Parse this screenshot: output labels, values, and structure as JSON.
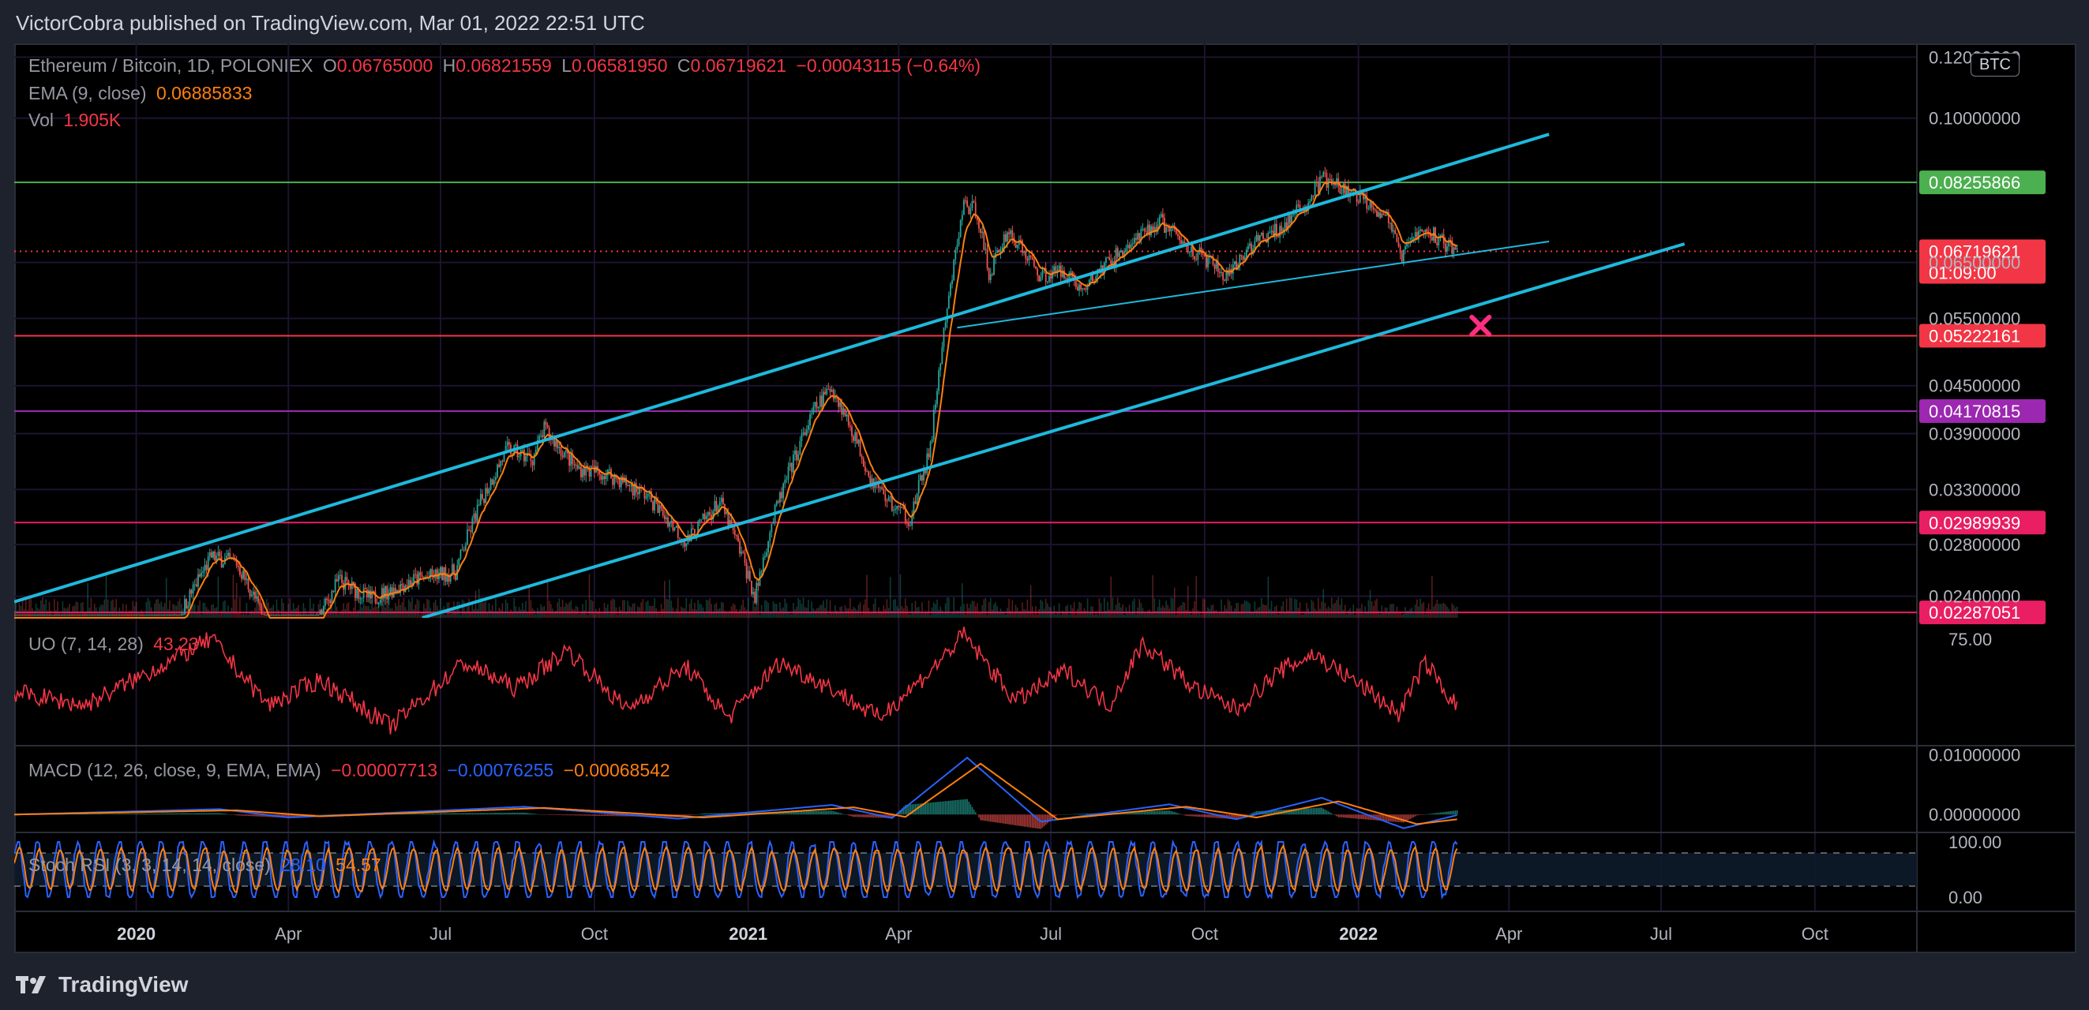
{
  "header": {
    "publisher": "VictorCobra published on TradingView.com, Mar 01, 2022 22:51 UTC"
  },
  "footer": {
    "brand": "TradingView"
  },
  "main_legend": {
    "symbol": "Ethereum / Bitcoin, 1D, POLONIEX",
    "o_label": "O",
    "o_value": "0.06765000",
    "h_label": "H",
    "h_value": "0.06821559",
    "l_label": "L",
    "l_value": "0.06581950",
    "c_label": "C",
    "c_value": "0.06719621",
    "change": "−0.00043115 (−0.64%)"
  },
  "ema_legend": {
    "label": "EMA (9, close)",
    "value": "0.06885833"
  },
  "vol_legend": {
    "label": "Vol",
    "value": "1.905K"
  },
  "uo_legend": {
    "label": "UO (7, 14, 28)",
    "value": "43.23"
  },
  "macd_legend": {
    "label": "MACD (12, 26, close, 9, EMA, EMA)",
    "v1": "−0.00007713",
    "v2": "−0.00076255",
    "v3": "−0.00068542"
  },
  "stoch_legend": {
    "label": "Stoch RSI (3, 3, 14, 14, close)",
    "v1": "28.10",
    "v2": "54.57"
  },
  "currency_badge": "BTC",
  "colors": {
    "background": "#000000",
    "up": "#26a69a",
    "down": "#ef5350",
    "ema": "#ff7f0e",
    "trendline": "#1eb9dc",
    "price_line": "#f23645",
    "green_level": "#4caf50",
    "pink_level": "#e91e63",
    "purple_level": "#9c27b0",
    "uo": "#f23645",
    "macd": "#2962ff",
    "signal": "#ff7f0e",
    "cross": "#ff2e7e"
  },
  "chart_data": {
    "type": "candlestick",
    "x_axis_labels": [
      "2020",
      "Apr",
      "Jul",
      "Oct",
      "2021",
      "Apr",
      "Jul",
      "Oct",
      "2022",
      "Apr",
      "Jul",
      "Oct"
    ],
    "x_range": [
      "2019-10-20",
      "2022-12-01"
    ],
    "price_scale": "log",
    "y_range": [
      0.0225,
      0.125
    ],
    "y_axis_labels": [
      "0.12000000",
      "0.10000000",
      "0.06500000",
      "0.05500000",
      "0.04500000",
      "0.03900000",
      "0.03300000",
      "0.02800000",
      "0.02400000"
    ],
    "price_path": [
      [
        "2019-10-20",
        0.0213
      ],
      [
        "2019-12-01",
        0.0198
      ],
      [
        "2020-01-10",
        0.0188
      ],
      [
        "2020-02-15",
        0.027
      ],
      [
        "2020-03-01",
        0.0265
      ],
      [
        "2020-03-20",
        0.0218
      ],
      [
        "2020-04-15",
        0.0215
      ],
      [
        "2020-05-01",
        0.0252
      ],
      [
        "2020-05-20",
        0.0238
      ],
      [
        "2020-06-15",
        0.0252
      ],
      [
        "2020-07-10",
        0.0258
      ],
      [
        "2020-07-25",
        0.0318
      ],
      [
        "2020-08-10",
        0.0372
      ],
      [
        "2020-08-25",
        0.0362
      ],
      [
        "2020-09-01",
        0.0395
      ],
      [
        "2020-09-20",
        0.0352
      ],
      [
        "2020-10-10",
        0.0345
      ],
      [
        "2020-11-01",
        0.0325
      ],
      [
        "2020-11-25",
        0.0282
      ],
      [
        "2020-12-15",
        0.0318
      ],
      [
        "2020-12-28",
        0.0272
      ],
      [
        "2021-01-05",
        0.0238
      ],
      [
        "2021-01-15",
        0.0298
      ],
      [
        "2021-01-25",
        0.0345
      ],
      [
        "2021-02-10",
        0.042
      ],
      [
        "2021-02-20",
        0.0448
      ],
      [
        "2021-03-05",
        0.039
      ],
      [
        "2021-03-15",
        0.0342
      ],
      [
        "2021-03-28",
        0.0315
      ],
      [
        "2021-04-08",
        0.0302
      ],
      [
        "2021-04-20",
        0.0372
      ],
      [
        "2021-05-01",
        0.058
      ],
      [
        "2021-05-10",
        0.0775
      ],
      [
        "2021-05-18",
        0.0755
      ],
      [
        "2021-05-25",
        0.0625
      ],
      [
        "2021-06-05",
        0.0715
      ],
      [
        "2021-06-25",
        0.0625
      ],
      [
        "2021-07-10",
        0.0635
      ],
      [
        "2021-07-20",
        0.0595
      ],
      [
        "2021-08-01",
        0.064
      ],
      [
        "2021-08-20",
        0.0692
      ],
      [
        "2021-09-05",
        0.0735
      ],
      [
        "2021-09-20",
        0.0682
      ],
      [
        "2021-10-05",
        0.0648
      ],
      [
        "2021-10-15",
        0.0618
      ],
      [
        "2021-10-28",
        0.0682
      ],
      [
        "2021-11-15",
        0.0718
      ],
      [
        "2021-12-01",
        0.0775
      ],
      [
        "2021-12-10",
        0.0835
      ],
      [
        "2021-12-25",
        0.0802
      ],
      [
        "2022-01-08",
        0.0778
      ],
      [
        "2022-01-20",
        0.0735
      ],
      [
        "2022-01-26",
        0.0655
      ],
      [
        "2022-02-05",
        0.0712
      ],
      [
        "2022-02-15",
        0.0705
      ],
      [
        "2022-03-01",
        0.0672
      ]
    ],
    "horizontal_levels": [
      {
        "price": 0.08255866,
        "label": "0.08255866",
        "color": "#4caf50"
      },
      {
        "price": 0.06719621,
        "label": "0.06719621",
        "sublabel": "01:09:00",
        "color": "#f23645",
        "dotted": true
      },
      {
        "price": 0.05222161,
        "label": "0.05222161",
        "color": "#f23645"
      },
      {
        "price": 0.04170815,
        "label": "0.04170815",
        "color": "#9c27b0"
      },
      {
        "price": 0.02989939,
        "label": "0.02989939",
        "color": "#e91e63"
      },
      {
        "price": 0.02287051,
        "label": "0.02287051",
        "color": "#e91e63"
      }
    ],
    "trendlines": [
      {
        "from": [
          "2019-10-20",
          0.0236
        ],
        "to": [
          "2022-04-25",
          0.0953
        ],
        "width": 4
      },
      {
        "from": [
          "2020-06-20",
          0.0225
        ],
        "to": [
          "2022-07-15",
          0.0687
        ],
        "width": 4
      },
      {
        "from": [
          "2021-05-06",
          0.0535
        ],
        "to": [
          "2022-04-25",
          0.0692
        ],
        "width": 2
      }
    ],
    "marker": {
      "date": "2022-03-15",
      "price": 0.0538,
      "shape": "x"
    },
    "volume_axis_max": 6.0,
    "uo": {
      "label": "UO (7, 14, 28)",
      "last": 43.23,
      "axis_labels": [
        "75.00"
      ],
      "range": [
        25,
        85
      ],
      "points": [
        [
          "2019-10-20",
          50
        ],
        [
          "2019-12-01",
          44
        ],
        [
          "2020-01-05",
          58
        ],
        [
          "2020-02-15",
          75
        ],
        [
          "2020-03-20",
          44
        ],
        [
          "2020-04-20",
          56
        ],
        [
          "2020-06-01",
          34
        ],
        [
          "2020-07-15",
          64
        ],
        [
          "2020-08-15",
          52
        ],
        [
          "2020-09-15",
          70
        ],
        [
          "2020-10-20",
          42
        ],
        [
          "2020-11-25",
          62
        ],
        [
          "2020-12-20",
          38
        ],
        [
          "2021-01-20",
          64
        ],
        [
          "2021-02-20",
          52
        ],
        [
          "2021-03-20",
          38
        ],
        [
          "2021-04-20",
          60
        ],
        [
          "2021-05-10",
          77
        ],
        [
          "2021-06-10",
          46
        ],
        [
          "2021-07-10",
          60
        ],
        [
          "2021-08-05",
          44
        ],
        [
          "2021-08-25",
          73
        ],
        [
          "2021-09-25",
          52
        ],
        [
          "2021-10-20",
          42
        ],
        [
          "2021-11-15",
          60
        ],
        [
          "2021-12-05",
          68
        ],
        [
          "2022-01-05",
          52
        ],
        [
          "2022-01-25",
          40
        ],
        [
          "2022-02-10",
          64
        ],
        [
          "2022-03-01",
          43
        ]
      ]
    },
    "macd": {
      "label": "MACD (12, 26, close, 9, EMA, EMA)",
      "axis_labels": [
        "0.01000000",
        "0.00000000"
      ],
      "range": [
        -0.003,
        0.0115
      ],
      "macd": [
        [
          "2019-10-20",
          0.0
        ],
        [
          "2020-02-20",
          0.0009
        ],
        [
          "2020-04-01",
          -0.0005
        ],
        [
          "2020-08-20",
          0.0013
        ],
        [
          "2020-11-20",
          -0.0007
        ],
        [
          "2021-02-20",
          0.0016
        ],
        [
          "2021-03-28",
          -0.0006
        ],
        [
          "2021-05-12",
          0.0095
        ],
        [
          "2021-06-25",
          -0.0012
        ],
        [
          "2021-09-10",
          0.0017
        ],
        [
          "2021-10-20",
          -0.0008
        ],
        [
          "2021-12-10",
          0.0028
        ],
        [
          "2022-01-28",
          -0.0023
        ],
        [
          "2022-03-01",
          -0.0001
        ]
      ],
      "signal": [
        [
          "2019-10-20",
          0.0
        ],
        [
          "2020-03-01",
          0.0007
        ],
        [
          "2020-04-20",
          -0.0003
        ],
        [
          "2020-09-01",
          0.0011
        ],
        [
          "2020-12-05",
          -0.0005
        ],
        [
          "2021-03-05",
          0.0012
        ],
        [
          "2021-04-05",
          -0.0004
        ],
        [
          "2021-05-20",
          0.0085
        ],
        [
          "2021-07-05",
          -0.0008
        ],
        [
          "2021-09-20",
          0.0013
        ],
        [
          "2021-11-01",
          -0.0005
        ],
        [
          "2021-12-20",
          0.0022
        ],
        [
          "2022-02-05",
          -0.0016
        ],
        [
          "2022-03-01",
          -0.0008
        ]
      ]
    },
    "stoch_rsi": {
      "label": "Stoch RSI (3, 3, 14, 14, close)",
      "k_last": 28.1,
      "d_last": 54.57,
      "axis_labels": [
        "100.00",
        "0.00"
      ],
      "bands": [
        80,
        20
      ],
      "range": [
        0,
        100
      ]
    }
  }
}
